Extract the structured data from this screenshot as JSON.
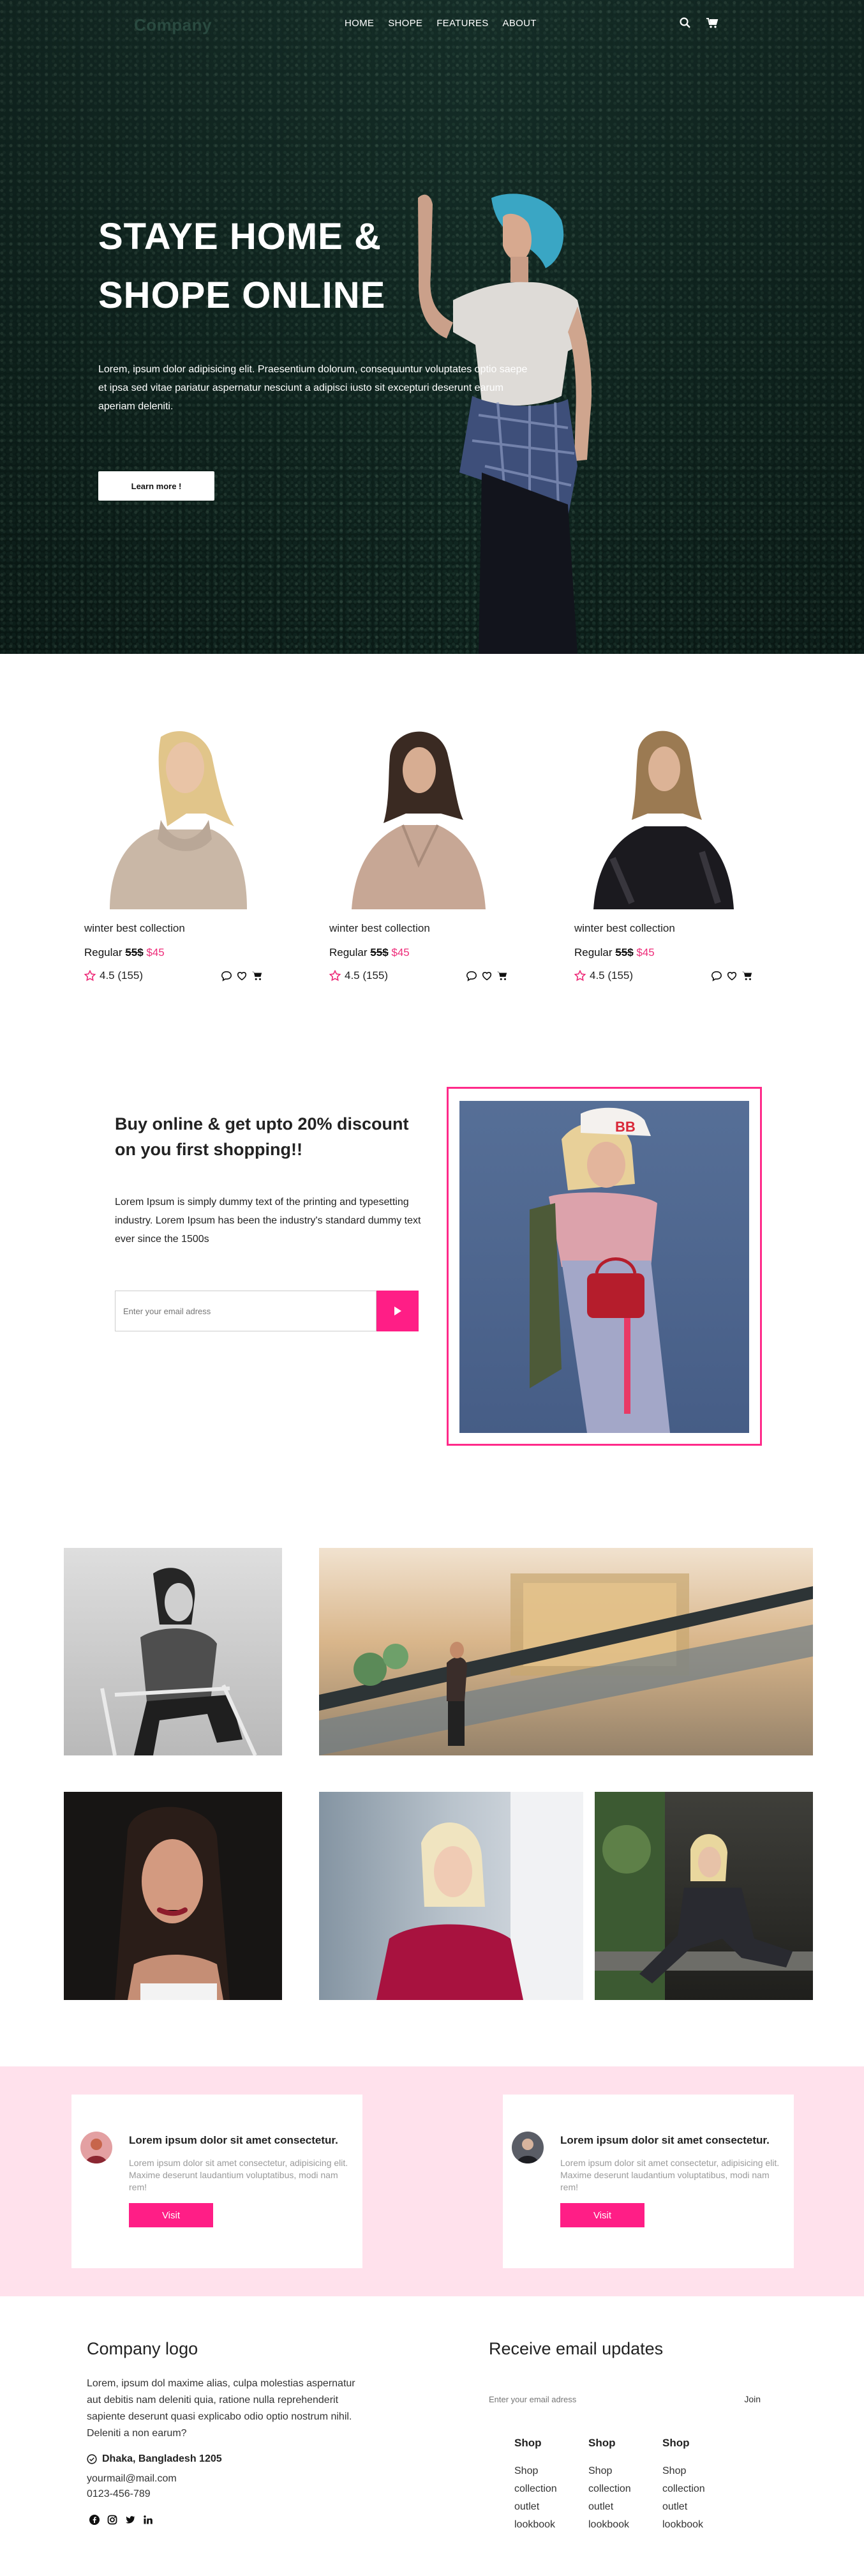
{
  "nav": {
    "logo": "Company",
    "links": [
      "HOME",
      "SHOPE",
      "FEATURES",
      "ABOUT"
    ],
    "icons": [
      "search-icon",
      "cart-icon"
    ]
  },
  "hero": {
    "title": "STAYE HOME & SHOPE ONLINE",
    "text": "Lorem, ipsum dolor adipisicing elit. Praesentium dolorum, consequuntur voluptates optio saepe et ipsa sed vitae pariatur aspernatur nesciunt a adipisci iusto sit excepturi deserunt earum aperiam deleniti.",
    "button": "Learn more !"
  },
  "products": [
    {
      "name": "winter best collection",
      "regular_label": "Regular",
      "old_price": "55$",
      "new_price": "$45",
      "rating": "4.5 (155)"
    },
    {
      "name": "winter best collection",
      "regular_label": "Regular",
      "old_price": "55$",
      "new_price": "$45",
      "rating": "4.5 (155)"
    },
    {
      "name": "winter best collection",
      "regular_label": "Regular",
      "old_price": "55$",
      "new_price": "$45",
      "rating": "4.5 (155)"
    }
  ],
  "promo": {
    "title": "Buy online & get upto 20% discount on you first shopping!!",
    "text": "Lorem Ipsum is simply dummy text of the printing and typesetting industry. Lorem Ipsum has been the industry's standard dummy text ever since the 1500s",
    "email_placeholder": "Enter your email adress"
  },
  "testimonials": [
    {
      "title": "Lorem ipsum dolor sit amet consectetur.",
      "text": "Lorem ipsum dolor sit amet consectetur, adipisicing elit. Maxime deserunt laudantium voluptatibus, modi nam rem!",
      "button": "Visit"
    },
    {
      "title": "Lorem ipsum dolor sit amet consectetur.",
      "text": "Lorem ipsum dolor sit amet consectetur, adipisicing elit. Maxime deserunt laudantium voluptatibus, modi nam rem!",
      "button": "Visit"
    }
  ],
  "footer": {
    "logo": "Company logo",
    "about": "Lorem, ipsum dol maxime alias, culpa molestias aspernatur aut debitis nam deleniti quia, ratione nulla reprehenderit sapiente deserunt quasi explicabo odio optio nostrum nihil. Deleniti a non earum?",
    "address": "Dhaka, Bangladesh 1205",
    "email": "yourmail@mail.com",
    "phone": "0123-456-789",
    "social": [
      "facebook-icon",
      "instagram-icon",
      "twitter-icon",
      "linkedin-icon"
    ],
    "updates_title": "Receive email updates",
    "updates_placeholder": "Enter your email adress",
    "join": "Join",
    "columns": [
      {
        "heading": "Shop",
        "items": [
          "Shop",
          "collection",
          "outlet",
          "lookbook"
        ]
      },
      {
        "heading": "Shop",
        "items": [
          "Shop",
          "collection",
          "outlet",
          "lookbook"
        ]
      },
      {
        "heading": "Shop",
        "items": [
          "Shop",
          "collection",
          "outlet",
          "lookbook"
        ]
      }
    ]
  },
  "colors": {
    "accent": "#ff1e86",
    "testimonial_bg": "#ffe1ec",
    "hero_bg": "#12291f"
  }
}
